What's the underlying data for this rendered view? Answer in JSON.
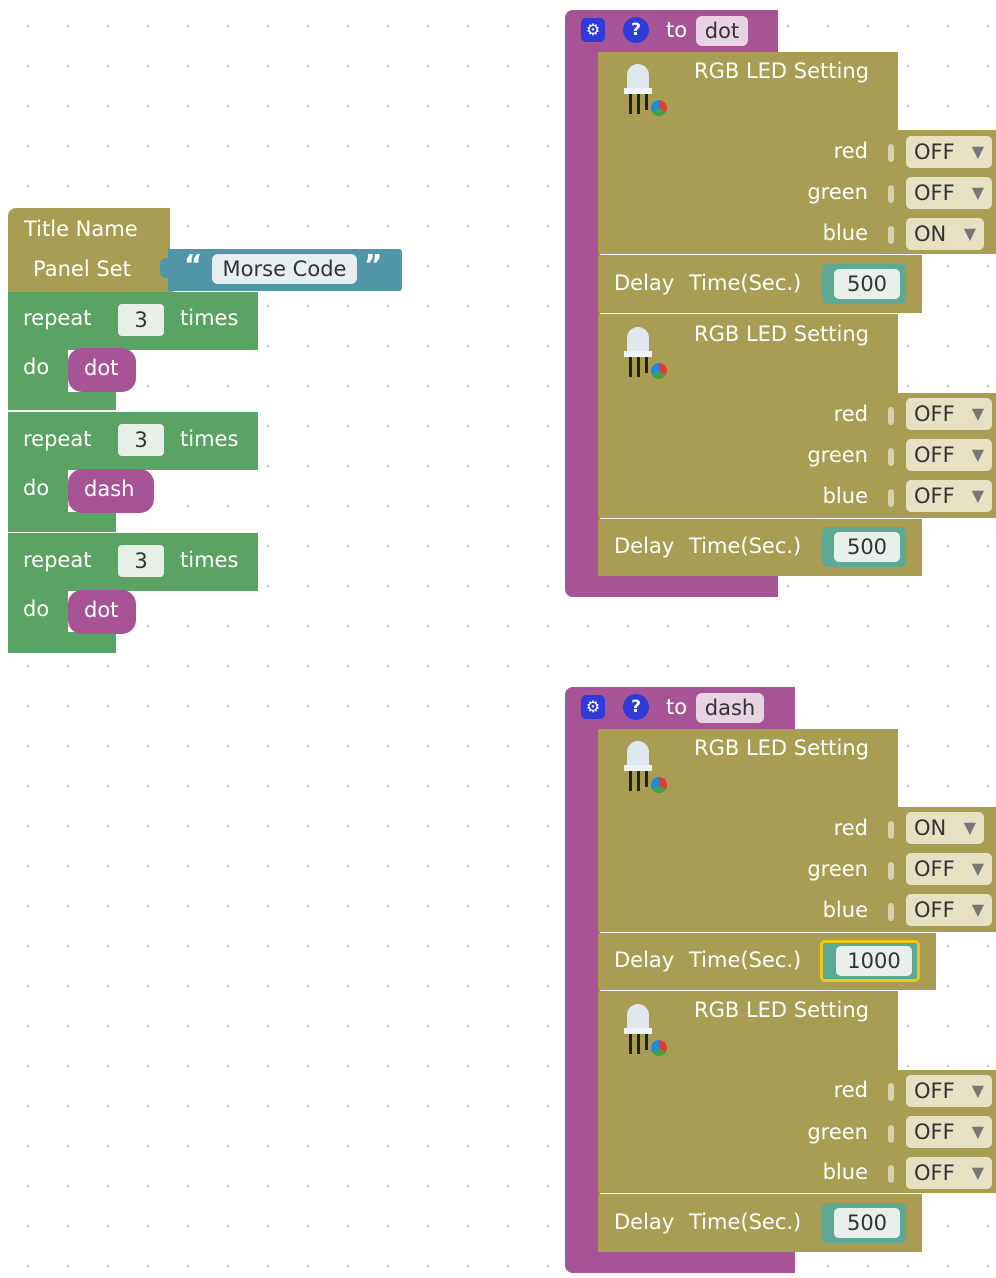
{
  "left_stack": {
    "title_block": {
      "line1": "Title Name",
      "line2": "Panel Set",
      "string_value": "Morse Code",
      "open_quote": "“",
      "close_quote": "”"
    },
    "repeats": [
      {
        "repeat_label": "repeat",
        "count": "3",
        "times_label": "times",
        "do_label": "do",
        "call": "dot"
      },
      {
        "repeat_label": "repeat",
        "count": "3",
        "times_label": "times",
        "do_label": "do",
        "call": "dash"
      },
      {
        "repeat_label": "repeat",
        "count": "3",
        "times_label": "times",
        "do_label": "do",
        "call": "dot"
      }
    ]
  },
  "procedures": [
    {
      "to_label": "to",
      "name": "dot",
      "blocks": [
        {
          "type": "led",
          "title": "RGB LED Setting",
          "red_label": "red",
          "green_label": "green",
          "blue_label": "blue",
          "red": "OFF",
          "green": "OFF",
          "blue": "ON"
        },
        {
          "type": "delay",
          "label": "Delay",
          "time_label": "Time(Sec.)",
          "value": "500"
        },
        {
          "type": "led",
          "title": "RGB LED Setting",
          "red_label": "red",
          "green_label": "green",
          "blue_label": "blue",
          "red": "OFF",
          "green": "OFF",
          "blue": "OFF"
        },
        {
          "type": "delay",
          "label": "Delay",
          "time_label": "Time(Sec.)",
          "value": "500"
        }
      ]
    },
    {
      "to_label": "to",
      "name": "dash",
      "blocks": [
        {
          "type": "led",
          "title": "RGB LED Setting",
          "red_label": "red",
          "green_label": "green",
          "blue_label": "blue",
          "red": "ON",
          "green": "OFF",
          "blue": "OFF"
        },
        {
          "type": "delay",
          "label": "Delay",
          "time_label": "Time(Sec.)",
          "value": "1000"
        },
        {
          "type": "led",
          "title": "RGB LED Setting",
          "red_label": "red",
          "green_label": "green",
          "blue_label": "blue",
          "red": "OFF",
          "green": "OFF",
          "blue": "OFF"
        },
        {
          "type": "delay",
          "label": "Delay",
          "time_label": "Time(Sec.)",
          "value": "500"
        }
      ]
    }
  ],
  "icons": {
    "gear": "gear-icon",
    "help": "help-icon",
    "led": "led-icon",
    "dropdown": "triangle-down-icon"
  },
  "colors": {
    "olive": "#a89d53",
    "purple": "#a75497",
    "green": "#5ba364",
    "teal": "#5196a6",
    "highlight": "#f0c419"
  }
}
